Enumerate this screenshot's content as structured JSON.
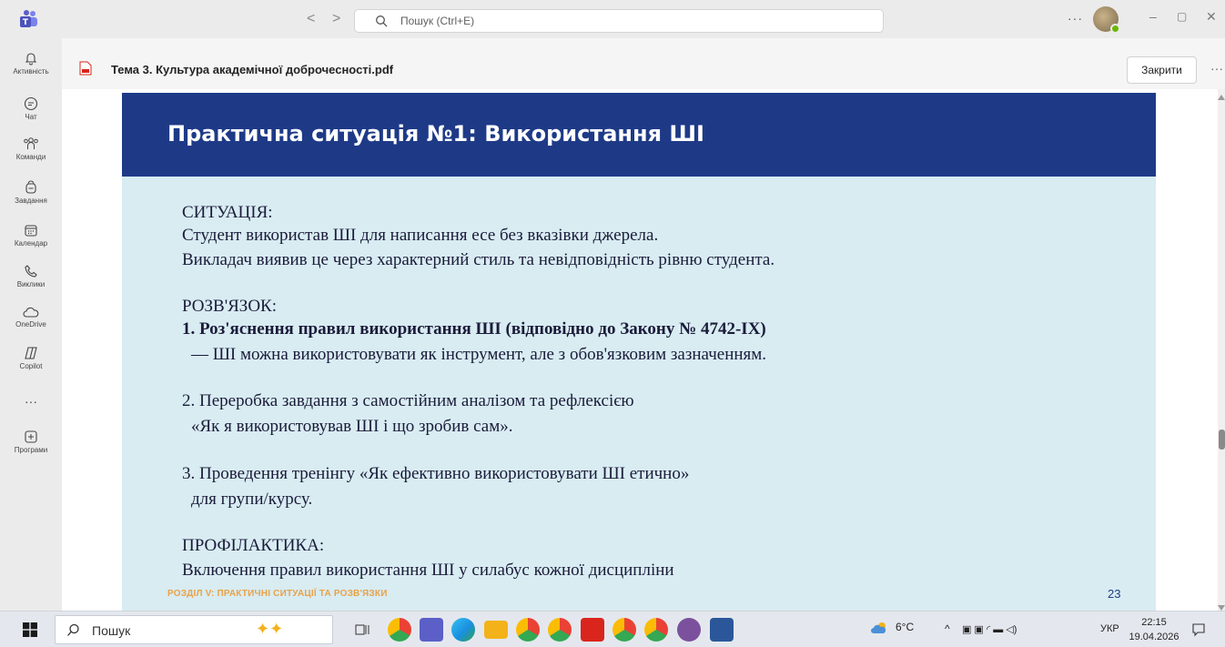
{
  "titlebar": {
    "back": "<",
    "forward": ">",
    "search_placeholder": "Пошук (Ctrl+E)",
    "more": "···",
    "minimize": "–",
    "restore": "▢",
    "close": "✕"
  },
  "rail": {
    "items": [
      {
        "label": "Активність",
        "icon": "bell-icon"
      },
      {
        "label": "Чат",
        "icon": "chat-icon"
      },
      {
        "label": "Команди",
        "icon": "teams-icon"
      },
      {
        "label": "Завдання",
        "icon": "tasks-icon"
      },
      {
        "label": "Календар",
        "icon": "calendar-icon"
      },
      {
        "label": "Виклики",
        "icon": "phone-icon"
      },
      {
        "label": "OneDrive",
        "icon": "cloud-icon"
      },
      {
        "label": "Copilot",
        "icon": "copilot-icon"
      }
    ],
    "more": "···",
    "apps_label": "Програми"
  },
  "file": {
    "title": "Тема 3. Культура академічної доброчесності.pdf",
    "close_label": "Закрити",
    "more": "···"
  },
  "slide": {
    "title": "Практична ситуація №1: Використання ШІ",
    "lines": [
      {
        "text": "СИТУАЦІЯ:",
        "bold": false
      },
      {
        "text": "Студент використав ШІ для написання есе без вказівки джерела.",
        "bold": false
      },
      {
        "text": "Викладач виявив це через характерний стиль та невідповідність рівню студента.",
        "bold": false
      },
      {
        "text": "РОЗВ'ЯЗОК:",
        "bold": false
      },
      {
        "text": "1. Роз'яснення правил використання ШІ (відповідно до Закону № 4742-IX)",
        "bold": true
      },
      {
        "text": "   — ШІ можна використовувати як інструмент, але з обов'язковим зазначенням.",
        "bold": false
      },
      {
        "text": "2. Переробка завдання з самостійним аналізом та рефлексією",
        "bold": false
      },
      {
        "text": "   «Як я використовував ШІ і що зробив сам».",
        "bold": false
      },
      {
        "text": "3. Проведення тренінгу «Як ефективно використовувати ШІ етично»",
        "bold": false
      },
      {
        "text": "   для групи/курсу.",
        "bold": false
      },
      {
        "text": "ПРОФІЛАКТИКА:",
        "bold": false
      },
      {
        "text": "Включення правил використання ШІ у силабус кожної дисципліни",
        "bold": false
      }
    ],
    "footer": "РОЗДІЛ V: ПРАКТИЧНІ СИТУАЦІЇ ТА РОЗВ'ЯЗКИ",
    "page_number": "23"
  },
  "taskbar": {
    "search_label": "Пошук",
    "weather": "6°C",
    "tray_icons": "^",
    "language": "УКР",
    "time": "22:15",
    "date": "19.04.2026",
    "apps": [
      {
        "name": "task-view-icon",
        "color": "#555555"
      },
      {
        "name": "chrome-icon",
        "color": "#e94235"
      },
      {
        "name": "teams-taskbar-icon",
        "color": "#5b5fc7"
      },
      {
        "name": "edge-icon",
        "color": "#1a8fe0"
      },
      {
        "name": "file-explorer-icon",
        "color": "#f3b21a"
      },
      {
        "name": "chrome-profile-icon",
        "color": "#e94235"
      },
      {
        "name": "chrome-profile-2-icon",
        "color": "#e94235"
      },
      {
        "name": "acrobat-icon",
        "color": "#d9251c"
      },
      {
        "name": "chrome-profile-3-icon",
        "color": "#e94235"
      },
      {
        "name": "chrome-profile-4-icon",
        "color": "#e94235"
      },
      {
        "name": "viber-icon",
        "color": "#7b519d"
      },
      {
        "name": "word-icon",
        "color": "#2b579a"
      }
    ]
  },
  "colors": {
    "slide_header": "#1e3a87",
    "slide_body": "#d8ecf2",
    "footer_text": "#e8a24a"
  }
}
